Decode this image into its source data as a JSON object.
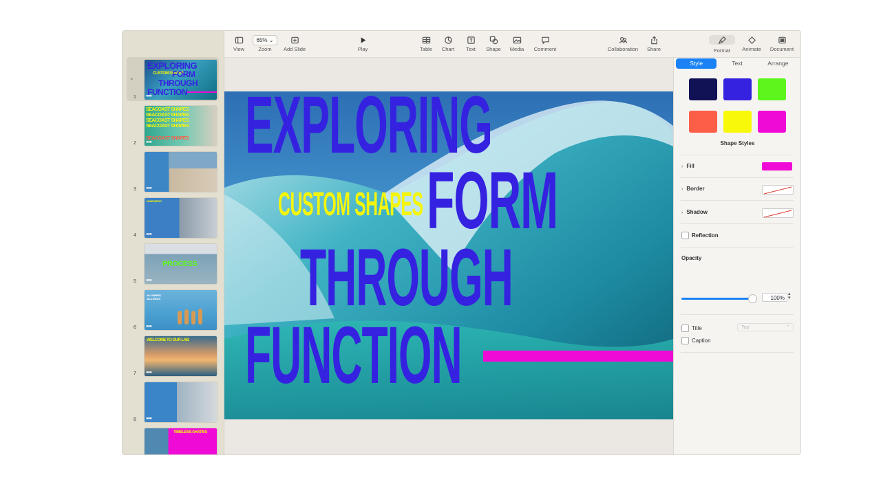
{
  "toolbar": {
    "view": "View",
    "zoom_value": "65%",
    "zoom": "Zoom",
    "add_slide": "Add Slide",
    "play": "Play",
    "table": "Table",
    "chart": "Chart",
    "text": "Text",
    "shape": "Shape",
    "media": "Media",
    "comment": "Comment",
    "collaboration": "Collaboration",
    "share": "Share",
    "format": "Format",
    "animate": "Animate",
    "document": "Document"
  },
  "slides": [
    {
      "num": "1",
      "lines": [
        "EXPLORING",
        "CUSTOM SHAPES",
        "FORM",
        "THROUGH",
        "FUNCTION"
      ]
    },
    {
      "num": "2",
      "lines": [
        "SEACOAST SHAPES",
        "SEACOAST SHAPES",
        "SEACOAST SHAPES",
        "SEACOAST SHAPES",
        "SEACOAST SHAPES"
      ]
    },
    {
      "num": "3"
    },
    {
      "num": "4",
      "lines": [
        "WHAT WE DO"
      ]
    },
    {
      "num": "5",
      "lines": [
        "PROCESS"
      ]
    },
    {
      "num": "6",
      "lines": [
        "ALL SHAPES,",
        "ALL LEVELS"
      ]
    },
    {
      "num": "7",
      "lines": [
        "WELCOME TO OUR LAB"
      ]
    },
    {
      "num": "8"
    },
    {
      "num": "9",
      "lines": [
        "TIMELESS SHAPES"
      ]
    }
  ],
  "slide_canvas": {
    "line1": "EXPLORING",
    "subtitle": "CUSTOM SHAPES",
    "line2": "FORM",
    "line3": "THROUGH",
    "line4": "FUNCTION"
  },
  "inspector": {
    "tabs": [
      "Style",
      "Text",
      "Arrange"
    ],
    "swatch_colors": [
      "#111155",
      "#3522e0",
      "#5cf51c",
      "#fd5e48",
      "#f8f80a",
      "#f00ad6"
    ],
    "shape_styles": "Shape Styles",
    "fill": "Fill",
    "fill_color": "#f00ad6",
    "border": "Border",
    "shadow": "Shadow",
    "reflection": "Reflection",
    "opacity": "Opacity",
    "opacity_value": "100%",
    "opacity_fraction": 1.0,
    "title": "Title",
    "title_position": "Top",
    "caption": "Caption"
  }
}
